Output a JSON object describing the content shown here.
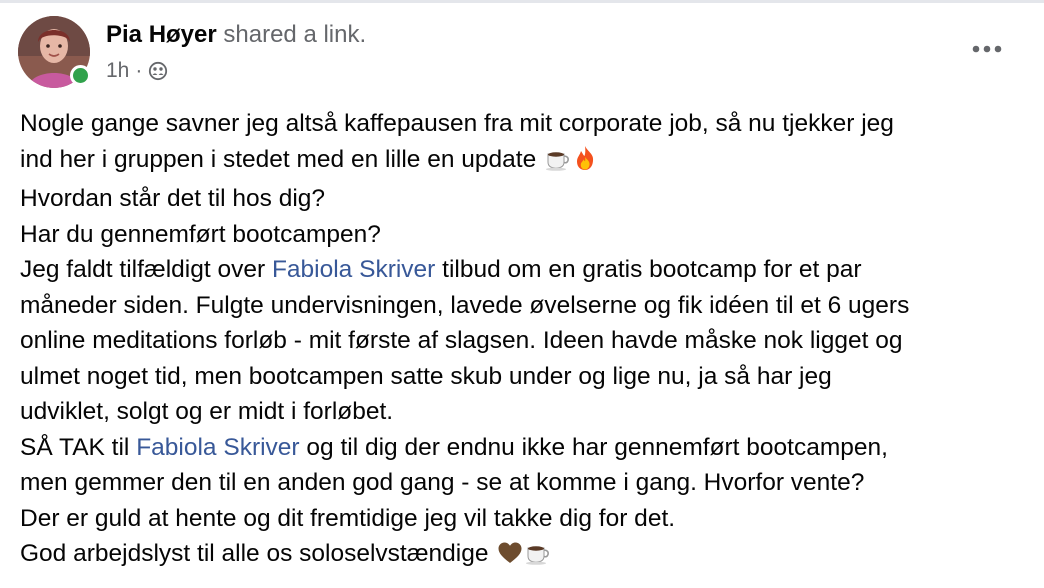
{
  "post": {
    "author": "Pia Høyer",
    "action": "shared a link.",
    "time": "1h",
    "separator": "·",
    "audience_icon": "group-audience-icon",
    "more_icon": "more-horizontal-icon",
    "online_color": "#31a24c",
    "mention_color": "#385898"
  },
  "content": {
    "l1": "Nogle gange savner jeg altså kaffepausen fra mit corporate job, så nu tjekker jeg",
    "l2": "ind her i gruppen i stedet med en lille en update",
    "l2_emojis": [
      "coffee-emoji",
      "fire-emoji"
    ],
    "l3": "Hvordan står det til hos dig?",
    "l4": "Har du gennemført bootcampen?",
    "l5_pre": "Jeg faldt tilfældigt over ",
    "mention_1": "Fabiola Skriver",
    "l5_post": " tilbud om en gratis bootcamp for et par",
    "l6": "måneder siden. Fulgte undervisningen, lavede øvelserne og fik idéen til et 6 ugers",
    "l7": "online meditations forløb - mit første af slagsen. Ideen havde måske nok ligget og",
    "l8": "ulmet noget tid, men bootcampen satte skub under og lige nu, ja så har jeg",
    "l9": "udviklet, solgt og er midt i forløbet.",
    "l10_pre": "SÅ TAK til ",
    "mention_2": "Fabiola Skriver",
    "l10_post": " og til dig der endnu ikke har gennemført bootcampen,",
    "l11": "men gemmer den til en anden god gang - se at komme i gang. Hvorfor vente?",
    "l12": "Der er guld  at hente og dit fremtidige jeg vil takke dig for det.",
    "l13": "God arbejdslyst til alle os soloselvstændige",
    "l13_emojis": [
      "brown-heart-emoji",
      "coffee-emoji"
    ]
  }
}
